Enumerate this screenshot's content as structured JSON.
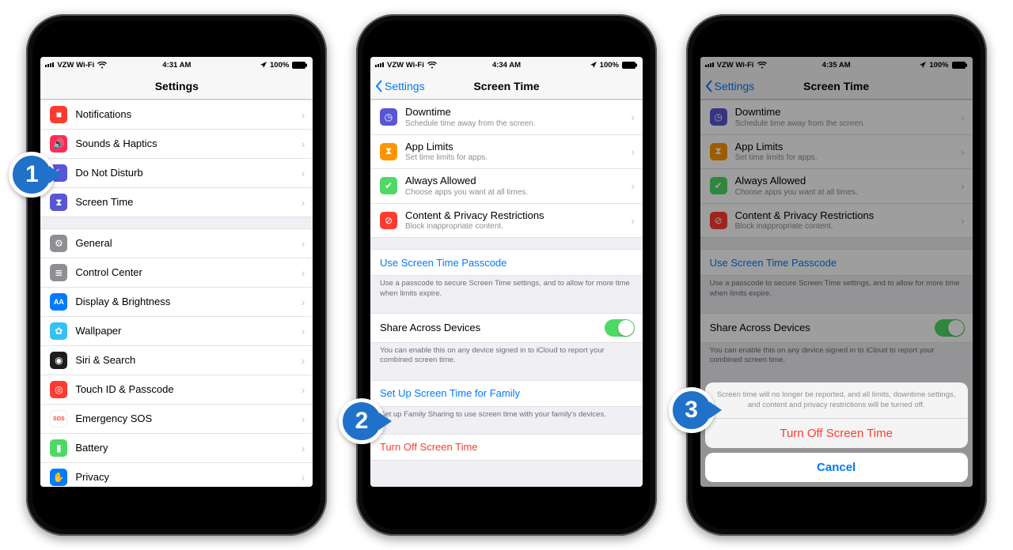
{
  "status": {
    "carrier": "VZW Wi-Fi",
    "battery": "100%"
  },
  "phones": [
    {
      "time": "4:31 AM",
      "nav": {
        "title": "Settings",
        "back": null
      },
      "dimmed": false,
      "groups": [
        {
          "footer": null,
          "cells": [
            {
              "icon_bg": "#ff3b30",
              "icon_name": "notifications-icon",
              "label": "Notifications",
              "sub": null,
              "type": "nav"
            },
            {
              "icon_bg": "#ff2d55",
              "icon_name": "sounds-icon",
              "label": "Sounds & Haptics",
              "sub": null,
              "type": "nav"
            },
            {
              "icon_bg": "#5856d6",
              "icon_name": "dnd-icon",
              "label": "Do Not Disturb",
              "sub": null,
              "type": "nav"
            },
            {
              "icon_bg": "#5856d6",
              "icon_name": "hourglass-icon",
              "label": "Screen Time",
              "sub": null,
              "type": "nav"
            }
          ]
        },
        {
          "footer": null,
          "cells": [
            {
              "icon_bg": "#8e8e93",
              "icon_name": "gear-icon",
              "label": "General",
              "sub": null,
              "type": "nav"
            },
            {
              "icon_bg": "#8e8e93",
              "icon_name": "sliders-icon",
              "label": "Control Center",
              "sub": null,
              "type": "nav"
            },
            {
              "icon_bg": "#007aff",
              "icon_name": "text-size-icon",
              "label": "Display & Brightness",
              "sub": null,
              "type": "nav"
            },
            {
              "icon_bg": "#35c1f1",
              "icon_name": "wallpaper-icon",
              "label": "Wallpaper",
              "sub": null,
              "type": "nav"
            },
            {
              "icon_bg": "#1d1d1f",
              "icon_name": "siri-icon",
              "label": "Siri & Search",
              "sub": null,
              "type": "nav"
            },
            {
              "icon_bg": "#ff3b30",
              "icon_name": "touchid-icon",
              "label": "Touch ID & Passcode",
              "sub": null,
              "type": "nav"
            },
            {
              "icon_bg": "#ff3b30",
              "icon_name": "sos-icon",
              "label": "Emergency SOS",
              "sub": null,
              "type": "nav"
            },
            {
              "icon_bg": "#4cd964",
              "icon_name": "battery-icon",
              "label": "Battery",
              "sub": null,
              "type": "nav"
            },
            {
              "icon_bg": "#007aff",
              "icon_name": "privacy-icon",
              "label": "Privacy",
              "sub": null,
              "type": "nav"
            }
          ]
        }
      ]
    },
    {
      "time": "4:34 AM",
      "nav": {
        "title": "Screen Time",
        "back": "Settings"
      },
      "dimmed": false,
      "groups": [
        {
          "footer": null,
          "cells": [
            {
              "icon_bg": "#5856d6",
              "icon_name": "downtime-icon",
              "label": "Downtime",
              "sub": "Schedule time away from the screen.",
              "type": "nav"
            },
            {
              "icon_bg": "#ff9500",
              "icon_name": "hourglass-icon",
              "label": "App Limits",
              "sub": "Set time limits for apps.",
              "type": "nav"
            },
            {
              "icon_bg": "#4cd964",
              "icon_name": "check-icon",
              "label": "Always Allowed",
              "sub": "Choose apps you want at all times.",
              "type": "nav"
            },
            {
              "icon_bg": "#ff3b30",
              "icon_name": "nosign-icon",
              "label": "Content & Privacy Restrictions",
              "sub": "Block inappropriate content.",
              "type": "nav"
            }
          ]
        },
        {
          "footer": "Use a passcode to secure Screen Time settings, and to allow for more time when limits expire.",
          "cells": [
            {
              "label": "Use Screen Time Passcode",
              "type": "link"
            }
          ]
        },
        {
          "footer": "You can enable this on any device signed in to iCloud to report your combined screen time.",
          "cells": [
            {
              "label": "Share Across Devices",
              "type": "toggle",
              "on": true
            }
          ]
        },
        {
          "footer": "Set up Family Sharing to use screen time with your family's devices.",
          "cells": [
            {
              "label": "Set Up Screen Time for Family",
              "type": "link"
            }
          ]
        },
        {
          "footer": null,
          "cells": [
            {
              "label": "Turn Off Screen Time",
              "type": "danger"
            }
          ]
        }
      ]
    },
    {
      "time": "4:35 AM",
      "nav": {
        "title": "Screen Time",
        "back": "Settings"
      },
      "dimmed": true,
      "groups": [
        {
          "footer": null,
          "cells": [
            {
              "icon_bg": "#5856d6",
              "icon_name": "downtime-icon",
              "label": "Downtime",
              "sub": "Schedule time away from the screen.",
              "type": "nav"
            },
            {
              "icon_bg": "#ff9500",
              "icon_name": "hourglass-icon",
              "label": "App Limits",
              "sub": "Set time limits for apps.",
              "type": "nav"
            },
            {
              "icon_bg": "#4cd964",
              "icon_name": "check-icon",
              "label": "Always Allowed",
              "sub": "Choose apps you want at all times.",
              "type": "nav"
            },
            {
              "icon_bg": "#ff3b30",
              "icon_name": "nosign-icon",
              "label": "Content & Privacy Restrictions",
              "sub": "Block inappropriate content.",
              "type": "nav"
            }
          ]
        },
        {
          "footer": "Use a passcode to secure Screen Time settings, and to allow for more time when limits expire.",
          "cells": [
            {
              "label": "Use Screen Time Passcode",
              "type": "link"
            }
          ]
        },
        {
          "footer": "You can enable this on any device signed in to iCloud to report your combined screen time.",
          "cells": [
            {
              "label": "Share Across Devices",
              "type": "toggle",
              "on": true
            }
          ]
        }
      ],
      "sheet": {
        "message": "Screen time will no longer be reported, and all limits, downtime settings, and content and privacy restrictions will be turned off.",
        "destructive": "Turn Off Screen Time",
        "cancel": "Cancel"
      }
    }
  ],
  "steps": [
    {
      "n": "1"
    },
    {
      "n": "2"
    },
    {
      "n": "3"
    }
  ],
  "icons": {
    "notifications-icon": "■",
    "sounds-icon": "🔊",
    "dnd-icon": "☾",
    "hourglass-icon": "⧗",
    "gear-icon": "⚙",
    "sliders-icon": "≣",
    "text-size-icon": "AA",
    "wallpaper-icon": "✿",
    "siri-icon": "◉",
    "touchid-icon": "◎",
    "sos-icon": "SOS",
    "battery-icon": "▮",
    "privacy-icon": "✋",
    "downtime-icon": "◷",
    "check-icon": "✔",
    "nosign-icon": "⊘"
  }
}
